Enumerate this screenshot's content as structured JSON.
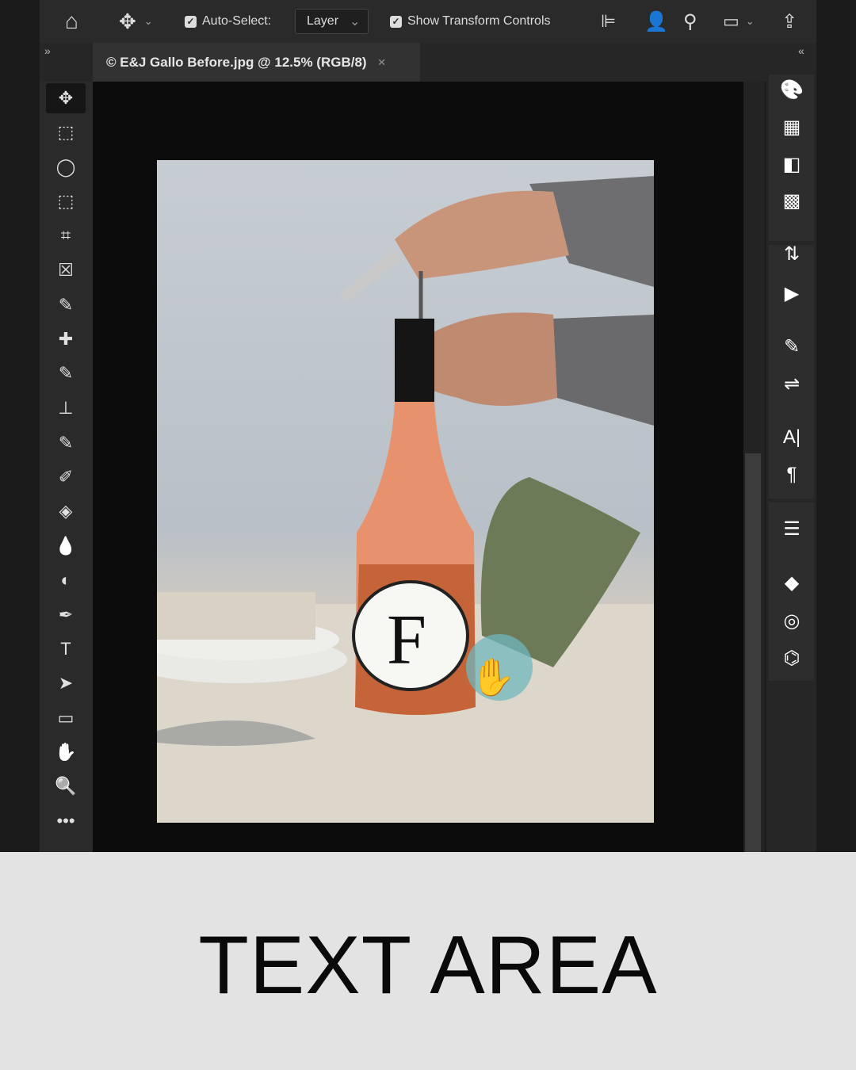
{
  "options_bar": {
    "home_icon": "home-icon",
    "move_icon": "move-icon",
    "auto_select_label": "Auto-Select:",
    "auto_select_checked": true,
    "auto_select_target": "Layer",
    "show_transform_label": "Show Transform Controls",
    "show_transform_checked": true
  },
  "document_tab": {
    "title": "© E&J Gallo Before.jpg @ 12.5% (RGB/8)",
    "close": "×"
  },
  "panel_toggles": {
    "left": "»",
    "right": "«"
  },
  "tools": [
    "move",
    "marquee",
    "lasso",
    "object-select",
    "crop",
    "frame",
    "eyedropper",
    "healing",
    "brush",
    "stamp",
    "history-brush",
    "eraser",
    "paint-bucket",
    "blur",
    "dodge",
    "pen",
    "type",
    "path-select",
    "rectangle",
    "hand",
    "zoom",
    "more"
  ],
  "tool_glyphs": [
    "✥",
    "⬚",
    "◯",
    "⬚",
    "⌗",
    "☒",
    "✎",
    "✚",
    "✎",
    "⊥",
    "✎",
    "✐",
    "◈",
    "💧",
    "◐",
    "✒",
    "T",
    "➤",
    "▭",
    "✋",
    "🔍",
    "•••"
  ],
  "right_panel_icons": [
    "color",
    "swatches",
    "gradient",
    "patterns",
    "history",
    "actions",
    "brush-settings",
    "properties",
    "character",
    "paragraph",
    "adjustments",
    "layers",
    "channels",
    "paths"
  ],
  "right_panel_glyphs": [
    "🎨",
    "▦",
    "◧",
    "▩",
    "⇅",
    "▶",
    "✎",
    "⇌",
    "A|",
    "¶",
    "☰",
    "◆",
    "◎",
    "⌬"
  ],
  "bottom_caption": "TEXT AREA"
}
